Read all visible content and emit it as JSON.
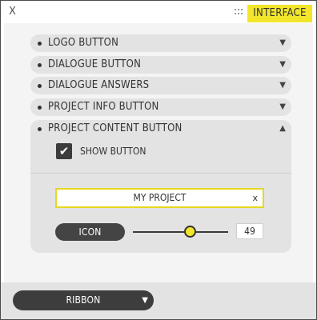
{
  "window": {
    "close_glyph": "X",
    "tab_label": "INTERFACE",
    "accent_color": "#f2e52a"
  },
  "accordion": {
    "items": [
      {
        "label": "LOGO BUTTON",
        "state": "collapsed",
        "chevron_glyph": "▼"
      },
      {
        "label": "DIALOGUE BUTTON",
        "state": "collapsed",
        "chevron_glyph": "▼"
      },
      {
        "label": "DIALOGUE ANSWERS",
        "state": "collapsed",
        "chevron_glyph": "▼"
      },
      {
        "label": "PROJECT INFO BUTTON",
        "state": "collapsed",
        "chevron_glyph": "▼"
      },
      {
        "label": "PROJECT CONTENT BUTTON",
        "state": "expanded",
        "chevron_glyph": "▲"
      }
    ]
  },
  "project_content": {
    "show_button": {
      "label": "SHOW BUTTON",
      "checked": true
    },
    "project_name": {
      "value": "MY PROJECT",
      "clear_glyph": "x"
    },
    "icon_button_label": "ICON",
    "icon_size": {
      "value": "49",
      "fraction": 0.55
    }
  },
  "footer": {
    "ribbon_label": "RIBBON",
    "ribbon_caret_glyph": "▼"
  },
  "icons": [
    "close-icon",
    "drag-grip-icon",
    "chevron-down-icon",
    "chevron-up-icon",
    "checkmark-icon",
    "clear-icon",
    "caret-down-icon"
  ]
}
